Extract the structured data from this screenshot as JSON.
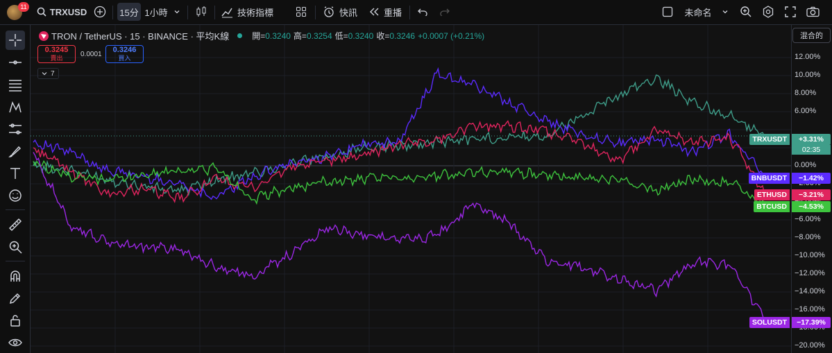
{
  "toolbar": {
    "notif_count": "11",
    "symbol": "TRXUSD",
    "interval_active": "15分",
    "interval_other": "1小時",
    "indicators": "技術指標",
    "quick": "快訊",
    "replay": "重播",
    "layout_name": "未命名"
  },
  "legend": {
    "title": "TRON / TetherUS · 15 · BINANCE · 平均K線",
    "open_label": "開=",
    "open": "0.3240",
    "high_label": "高=",
    "high": "0.3254",
    "low_label": "低=",
    "low": "0.3240",
    "close_label": "收=",
    "close": "0.3246",
    "change": "+0.0007 (+0.21%)",
    "sell_price": "0.3245",
    "sell_label": "賣出",
    "spread": "0.0001",
    "buy_price": "0.3246",
    "buy_label": "買入",
    "collapse_count": "7"
  },
  "price_scale_mode": "混合的",
  "axis_ticks": [
    "12.00%",
    "10.00%",
    "8.00%",
    "6.00%",
    "4.00%",
    "2.00%",
    "0.00%",
    "−2.00%",
    "−4.00%",
    "−6.00%",
    "−8.00%",
    "−10.00%",
    "−12.00%",
    "−14.00%",
    "−16.00%",
    "−18.00%",
    "−20.00%"
  ],
  "colors": {
    "TRXUSDT": "#3f9e8a",
    "BNBUSDT": "#5b2bff",
    "ETHUSD": "#e0245e",
    "BTCUSD": "#3ec43e",
    "SOLUSDT": "#9c27e6",
    "TRX_down": "#e05a4a"
  },
  "series_tags": {
    "trx": {
      "name": "TRXUSDT",
      "value": "+3.31%",
      "countdown": "02:35"
    },
    "bnb": {
      "name": "BNBUSDT",
      "value": "−1.42%"
    },
    "eth": {
      "name": "ETHUSD",
      "value": "−3.21%"
    },
    "btc": {
      "name": "BTCUSD",
      "value": "−4.53%"
    },
    "sol": {
      "name": "SOLUSDT",
      "value": "−17.39%"
    }
  },
  "chart_data": {
    "type": "line",
    "ylabel": "",
    "ylim": [
      -20.5,
      13
    ],
    "x": [
      0,
      5,
      10,
      15,
      20,
      25,
      30,
      35,
      40,
      45,
      50,
      55,
      60,
      65,
      70,
      75,
      80,
      85,
      90,
      95,
      100
    ],
    "series": [
      {
        "name": "TRXUSDT",
        "values": [
          0,
          -0.5,
          -1.5,
          -2.3,
          -2.8,
          -1.6,
          -0.8,
          0.2,
          1.0,
          2.0,
          2.2,
          2.7,
          3.0,
          3.2,
          3.3,
          5.5,
          7.8,
          9.8,
          7.0,
          5.5,
          3.31
        ]
      },
      {
        "name": "BNBUSDT",
        "values": [
          2.6,
          1.5,
          -0.5,
          -1.2,
          -2.0,
          -3.5,
          -1.2,
          0.2,
          1.0,
          2.3,
          2.6,
          10.2,
          9.0,
          7.0,
          5.0,
          3.5,
          2.5,
          3.0,
          1.5,
          3.5,
          -1.42
        ]
      },
      {
        "name": "ETHUSD",
        "values": [
          2.0,
          -0.5,
          -3.2,
          -2.5,
          -3.7,
          -1.5,
          -2.5,
          -0.2,
          0.5,
          1.2,
          2.4,
          2.8,
          4.5,
          4.3,
          3.8,
          2.5,
          0.5,
          4.0,
          2.5,
          3.2,
          -3.21
        ]
      },
      {
        "name": "BTCUSD",
        "values": [
          0.5,
          -1.2,
          -1.5,
          -1.0,
          -0.5,
          -0.3,
          -3.7,
          -2.5,
          -1.8,
          -1.5,
          -1.3,
          -1.2,
          -0.7,
          -0.6,
          -1.1,
          -1.4,
          -1.5,
          -2.8,
          -1.5,
          -1.8,
          -4.53
        ]
      },
      {
        "name": "SOLUSDT",
        "values": [
          1.5,
          -6.5,
          -8.5,
          -9.0,
          -9.2,
          -11.3,
          -12.2,
          -9.8,
          -7.0,
          -7.6,
          -8.2,
          -7.8,
          -4.2,
          -6.5,
          -10.5,
          -11.2,
          -12.6,
          -13.8,
          -10.7,
          -11.0,
          -17.39
        ]
      }
    ]
  }
}
